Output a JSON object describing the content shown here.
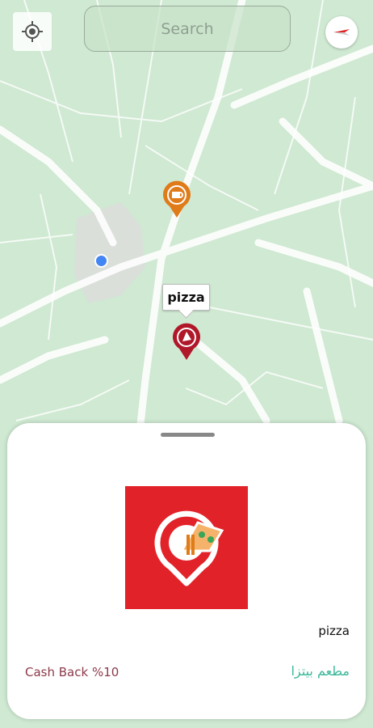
{
  "search": {
    "placeholder": "Search"
  },
  "map": {
    "marker_label": "pizza",
    "pins": [
      {
        "name": "coffee-pin",
        "color": "#e07b1a"
      },
      {
        "name": "pizza-pin",
        "color": "#b0182a"
      }
    ]
  },
  "sheet": {
    "name_en": "pizza",
    "name_ar": "مطعم بيتزا",
    "cashback": "Cash Back   %10",
    "logo_color": "#e22229"
  }
}
